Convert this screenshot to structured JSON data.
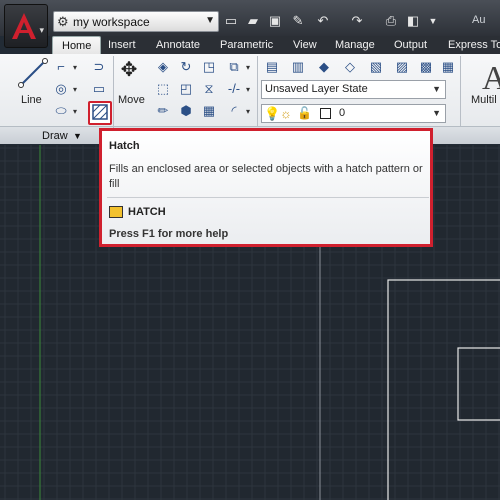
{
  "titlebar": {
    "workspace": "my workspace",
    "app_title_partial": "Au"
  },
  "tabs": [
    "Home",
    "Insert",
    "Annotate",
    "Parametric",
    "View",
    "Manage",
    "Output",
    "Express To"
  ],
  "ribbon": {
    "draw": {
      "line_label": "Line",
      "panel_label": "Draw"
    },
    "modify": {
      "move_label": "Move"
    },
    "layers": {
      "layer_state": "Unsaved Layer State",
      "current_layer": "0"
    },
    "annotation": {
      "multiline_label": "Multil"
    }
  },
  "tooltip": {
    "title": "Hatch",
    "description": "Fills an enclosed area or selected objects with a hatch pattern or fill",
    "command": "HATCH",
    "help": "Press F1 for more help"
  },
  "colors": {
    "canvas_bg": "#212830",
    "highlight": "#d0202e",
    "grid_line": "#2d353e",
    "axis_line": "#3a8a3a"
  }
}
